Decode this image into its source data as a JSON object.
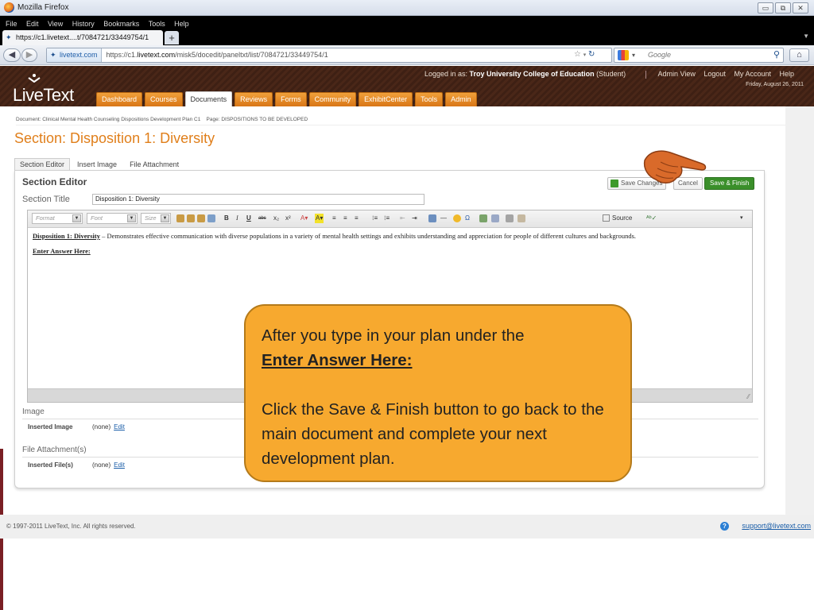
{
  "browser": {
    "window_title": "Mozilla Firefox",
    "menu": [
      "File",
      "Edit",
      "View",
      "History",
      "Bookmarks",
      "Tools",
      "Help"
    ],
    "tab_title": "https://c1.livetext....t/7084721/33449754/1",
    "new_tab": "+",
    "site_badge": "livetext.com",
    "url_prefix": "https://c1.",
    "url_domain": "livetext.com",
    "url_path": "/misk5/docedit/paneltxt/list/7084721/33449754/1",
    "search_placeholder": "Google"
  },
  "header": {
    "logo": "LiveText",
    "logged_in_prefix": "Logged in as: ",
    "institution": "Troy University College of Education",
    "role": " (Student)",
    "links": [
      "Admin View",
      "Logout",
      "My Account",
      "Help"
    ],
    "date": "Friday, August 26, 2011",
    "nav_tabs": [
      "Dashboard",
      "Courses",
      "Documents",
      "Reviews",
      "Forms",
      "Community",
      "ExhibitCenter",
      "Tools",
      "Admin"
    ],
    "active_tab": "Documents"
  },
  "page": {
    "breadcrumb": "Document: Clinical Mental Health Counseling Dispositions Development Plan C1    Page: DISPOSITIONS TO BE DEVELOPED",
    "section_title": "Section: Disposition 1: Diversity",
    "subtabs": [
      "Section Editor",
      "Insert Image",
      "File Attachment"
    ],
    "panel_title": "Section Editor",
    "save_changes": "Save Changes",
    "cancel": "Cancel",
    "save_finish": "Save & Finish",
    "title_label": "Section Title",
    "title_value": "Disposition 1: Diversity"
  },
  "editor": {
    "format_label": "Format",
    "font_label": "Font",
    "size_label": "Size",
    "source_label": "Source",
    "body_label": "Disposition 1:  Diversity",
    "body_text": " – Demonstrates effective communication with diverse populations in a variety of mental health settings and exhibits understanding and appreciation for people of different cultures and backgrounds.",
    "answer_label": "Enter Answer Here:"
  },
  "attachments": {
    "image_header": "Image",
    "image_label": "Inserted Image",
    "image_value": "(none)",
    "file_header": "File Attachment(s)",
    "file_label": "Inserted File(s)",
    "file_value": "(none)",
    "edit_link": "Edit"
  },
  "callout": {
    "line1": "After you type in your plan under the",
    "line2": "Enter Answer Here:",
    "line3": "Click the Save & Finish button to go back to the main document and complete your next development plan."
  },
  "footer": {
    "copyright": "© 1997-2011 LiveText, Inc. All rights reserved.",
    "support": "support@livetext.com"
  },
  "colors": {
    "accent_orange": "#e07f1b",
    "tab_orange": "#d97617",
    "header_brown": "#4a2718",
    "save_green": "#3a8f2a",
    "callout_fill": "#f7a92f"
  }
}
